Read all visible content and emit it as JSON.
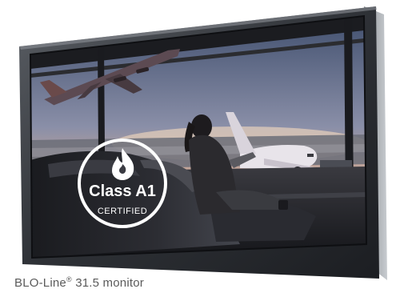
{
  "product": {
    "caption_name": "BLO-Line",
    "caption_mark": "®",
    "caption_rest": " 31.5 monitor"
  },
  "badge": {
    "line1": "Class A1",
    "line2": "CERTIFIED",
    "icon": "flame-icon"
  },
  "colors": {
    "bezel": "#3a3d42",
    "sky_top": "#4a5a7a",
    "sky_horizon": "#e8b08a",
    "badge": "#ffffff"
  }
}
